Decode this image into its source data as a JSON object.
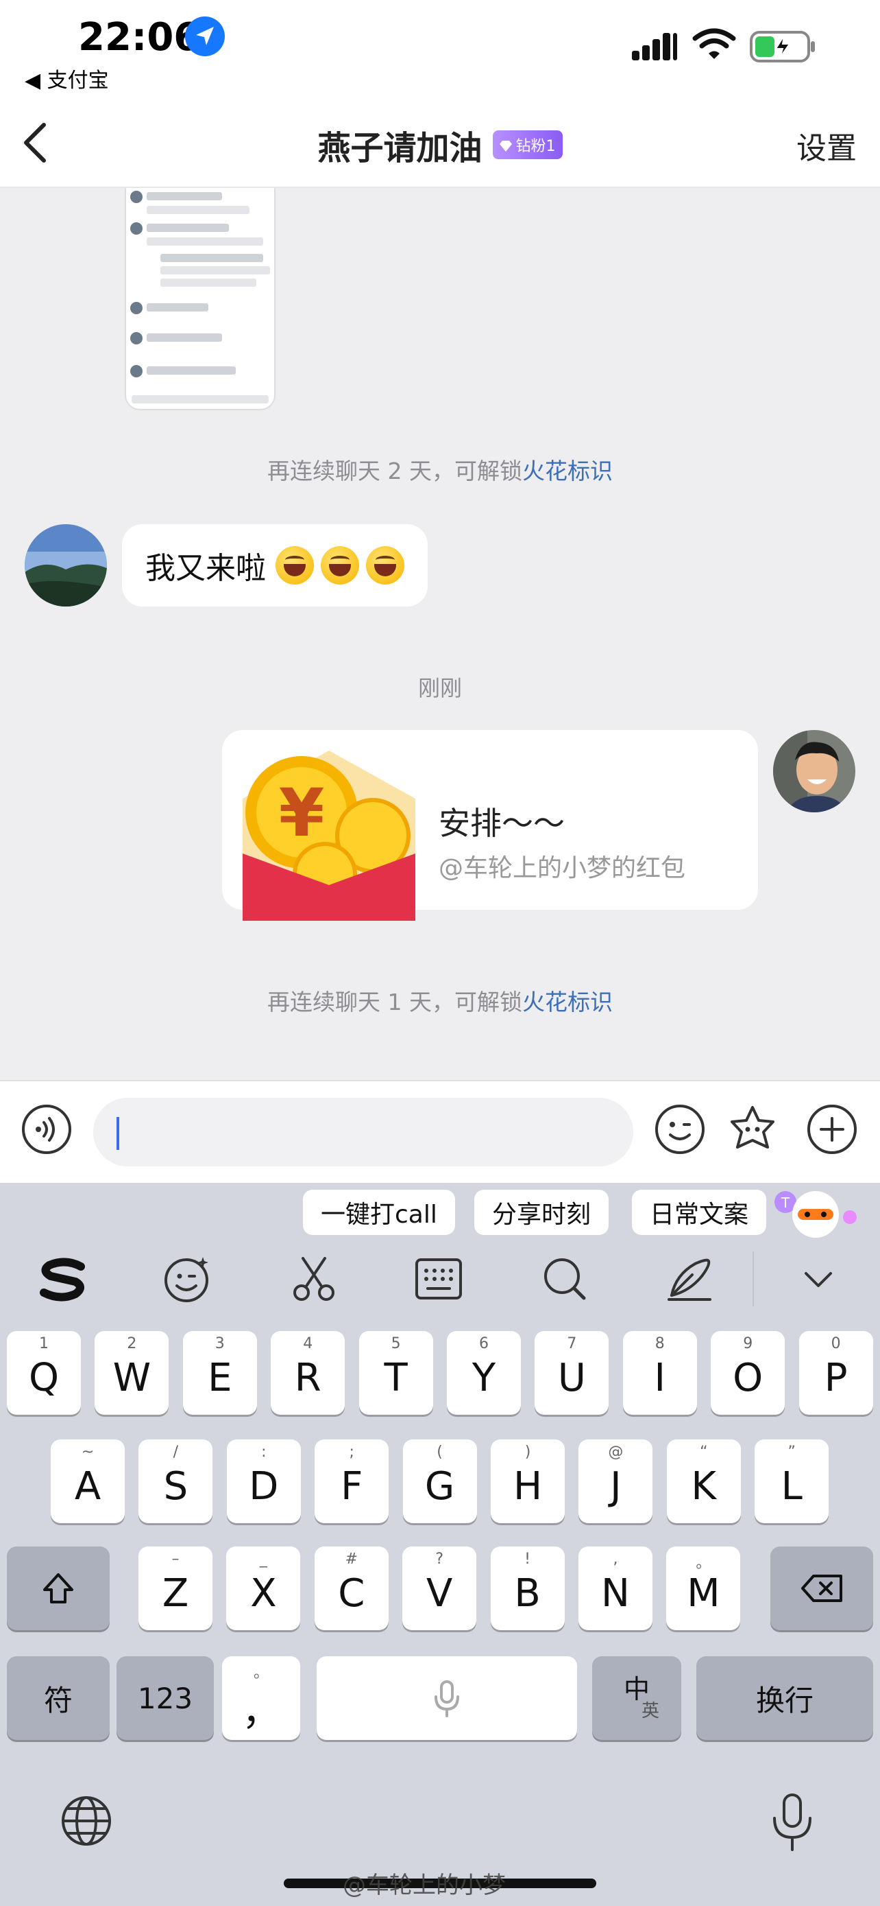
{
  "status_bar": {
    "time": "22:06",
    "back_app": "◀ 支付宝",
    "icons": [
      "location-icon",
      "cellular-signal-icon",
      "wifi-icon",
      "battery-charging-icon"
    ]
  },
  "nav": {
    "title": "燕子请加油",
    "badge": "钻粉1",
    "settings": "设置"
  },
  "chat": {
    "notice_1_prefix": "再连续聊天 2 天，可解锁",
    "notice_1_link": "火花标识",
    "incoming_text": "我又来啦",
    "timestamp": "刚刚",
    "red_packet_title": "安排～～",
    "red_packet_sub": "@车轮上的小梦的红包",
    "notice_2_prefix": "再连续聊天 1 天，可解锁",
    "notice_2_link": "火花标识"
  },
  "suggestions": [
    "一键打call",
    "分享时刻",
    "日常文案"
  ],
  "keyboard": {
    "row1": [
      {
        "hint": "1",
        "key": "Q"
      },
      {
        "hint": "2",
        "key": "W"
      },
      {
        "hint": "3",
        "key": "E"
      },
      {
        "hint": "4",
        "key": "R"
      },
      {
        "hint": "5",
        "key": "T"
      },
      {
        "hint": "6",
        "key": "Y"
      },
      {
        "hint": "7",
        "key": "U"
      },
      {
        "hint": "8",
        "key": "I"
      },
      {
        "hint": "9",
        "key": "O"
      },
      {
        "hint": "0",
        "key": "P"
      }
    ],
    "row2": [
      {
        "hint": "~",
        "key": "A"
      },
      {
        "hint": "/",
        "key": "S"
      },
      {
        "hint": ":",
        "key": "D"
      },
      {
        "hint": ";",
        "key": "F"
      },
      {
        "hint": "(",
        "key": "G"
      },
      {
        "hint": ")",
        "key": "H"
      },
      {
        "hint": "@",
        "key": "J"
      },
      {
        "hint": "“",
        "key": "K"
      },
      {
        "hint": "”",
        "key": "L"
      }
    ],
    "row3": [
      {
        "hint": "–",
        "key": "Z"
      },
      {
        "hint": "_",
        "key": "X"
      },
      {
        "hint": "#",
        "key": "C"
      },
      {
        "hint": "?",
        "key": "V"
      },
      {
        "hint": "!",
        "key": "B"
      },
      {
        "hint": ",",
        "key": "N"
      },
      {
        "hint": "。",
        "key": "M"
      }
    ],
    "symbol_key": "符",
    "num_key": "123",
    "comma_key": "，",
    "comma_hint": "。",
    "lang_main": "中",
    "lang_sub": "英",
    "return_key": "换行"
  },
  "watermark": "@车轮上的小梦"
}
